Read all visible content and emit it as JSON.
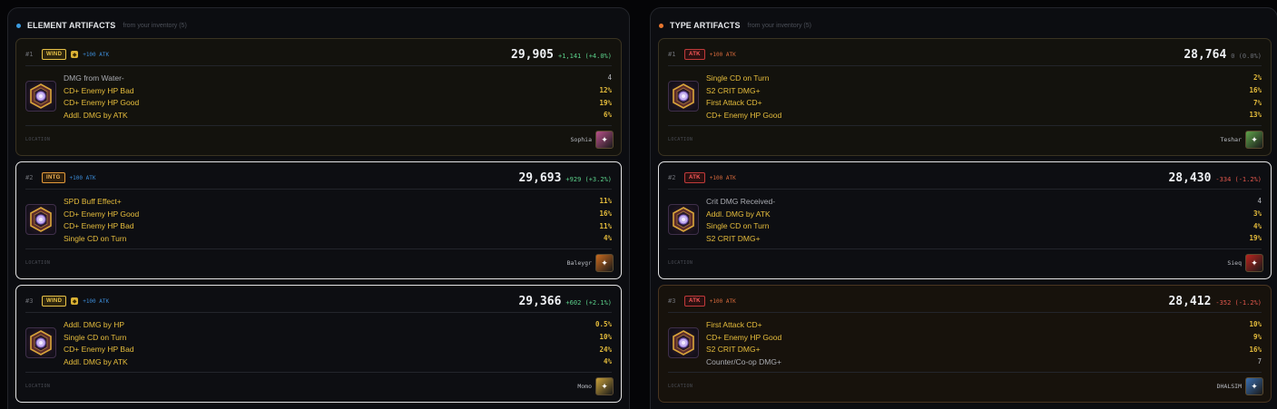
{
  "element_panel": {
    "title": "ELEMENT ARTIFACTS",
    "subtitle": "from your inventory (5)",
    "dot_color": "#3b9be0",
    "cards": [
      {
        "rank": "#1",
        "tag": "WIND",
        "tag_style": "wind",
        "has_set_icon": true,
        "main_stat": "+100 ATK",
        "score": "29,905",
        "delta": "+1,141 (+4.0%)",
        "delta_style": "pos",
        "card_style": "gold",
        "stats": [
          {
            "name": "DMG from Water-",
            "value": "4",
            "dim": true
          },
          {
            "name": "CD+ Enemy HP Bad",
            "value": "12%",
            "dim": false
          },
          {
            "name": "CD+ Enemy HP Good",
            "value": "19%",
            "dim": false
          },
          {
            "name": "Addl. DMG by ATK",
            "value": "6%",
            "dim": false
          }
        ],
        "location_label": "LOCATION",
        "hero": "Sophia",
        "avatar_color": "#b8518a"
      },
      {
        "rank": "#2",
        "tag": "INTG",
        "tag_style": "intg",
        "has_set_icon": false,
        "main_stat": "+100 ATK",
        "score": "29,693",
        "delta": "+929 (+3.2%)",
        "delta_style": "pos",
        "card_style": "white",
        "stats": [
          {
            "name": "SPD Buff Effect+",
            "value": "11%",
            "dim": false
          },
          {
            "name": "CD+ Enemy HP Good",
            "value": "16%",
            "dim": false
          },
          {
            "name": "CD+ Enemy HP Bad",
            "value": "11%",
            "dim": false
          },
          {
            "name": "Single CD on Turn",
            "value": "4%",
            "dim": false
          }
        ],
        "location_label": "LOCATION",
        "hero": "Baleygr",
        "avatar_color": "#c96a1e"
      },
      {
        "rank": "#3",
        "tag": "WIND",
        "tag_style": "wind",
        "has_set_icon": true,
        "main_stat": "+100 ATK",
        "score": "29,366",
        "delta": "+602 (+2.1%)",
        "delta_style": "pos",
        "card_style": "white",
        "stats": [
          {
            "name": "Addl. DMG by HP",
            "value": "0.5%",
            "dim": false
          },
          {
            "name": "Single CD on Turn",
            "value": "10%",
            "dim": false
          },
          {
            "name": "CD+ Enemy HP Bad",
            "value": "24%",
            "dim": false
          },
          {
            "name": "Addl. DMG by ATK",
            "value": "4%",
            "dim": false
          }
        ],
        "location_label": "LOCATION",
        "hero": "Momo",
        "avatar_color": "#c9a13a"
      }
    ]
  },
  "type_panel": {
    "title": "TYPE ARTIFACTS",
    "subtitle": "from your inventory (5)",
    "dot_color": "#e8762e",
    "cards": [
      {
        "rank": "#1",
        "tag": "ATK",
        "tag_style": "atk",
        "has_set_icon": false,
        "main_stat": "+100 ATK",
        "score": "28,764",
        "delta": "0 (0.0%)",
        "delta_style": "neu",
        "card_style": "gold",
        "stats": [
          {
            "name": "Single CD on Turn",
            "value": "2%",
            "dim": false
          },
          {
            "name": "S2 CRIT DMG+",
            "value": "16%",
            "dim": false
          },
          {
            "name": "First Attack CD+",
            "value": "7%",
            "dim": false
          },
          {
            "name": "CD+ Enemy HP Good",
            "value": "13%",
            "dim": false
          }
        ],
        "location_label": "LOCATION",
        "hero": "Teshar",
        "avatar_color": "#5fa34a"
      },
      {
        "rank": "#2",
        "tag": "ATK",
        "tag_style": "atk",
        "has_set_icon": false,
        "main_stat": "+100 ATK",
        "score": "28,430",
        "delta": "-334 (-1.2%)",
        "delta_style": "neg",
        "card_style": "white",
        "stats": [
          {
            "name": "Crit DMG Received-",
            "value": "4",
            "dim": true
          },
          {
            "name": "Addl. DMG by ATK",
            "value": "3%",
            "dim": false
          },
          {
            "name": "Single CD on Turn",
            "value": "4%",
            "dim": false
          },
          {
            "name": "S2 CRIT DMG+",
            "value": "19%",
            "dim": false
          }
        ],
        "location_label": "LOCATION",
        "hero": "Sieq",
        "avatar_color": "#b8241e"
      },
      {
        "rank": "#3",
        "tag": "ATK",
        "tag_style": "atk",
        "has_set_icon": false,
        "main_stat": "+100 ATK",
        "score": "28,412",
        "delta": "-352 (-1.2%)",
        "delta_style": "neg",
        "card_style": "brown",
        "stats": [
          {
            "name": "First Attack CD+",
            "value": "10%",
            "dim": false
          },
          {
            "name": "CD+ Enemy HP Good",
            "value": "9%",
            "dim": false
          },
          {
            "name": "S2 CRIT DMG+",
            "value": "16%",
            "dim": false
          },
          {
            "name": "Counter/Co-op DMG+",
            "value": "7",
            "dim": true
          }
        ],
        "location_label": "LOCATION",
        "hero": "DHALSIM",
        "avatar_color": "#3a6fb0"
      }
    ]
  }
}
